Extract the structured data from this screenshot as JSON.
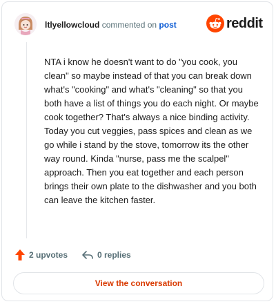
{
  "header": {
    "username": "ltlyellowcloud",
    "action_text": "commented on",
    "post_link": "post",
    "brand": "reddit",
    "brand_color": "#ff4500"
  },
  "comment": {
    "text": "NTA i know he doesn't want to do \"you cook, you clean\" so maybe instead of that you can break down what's \"cooking\" and what's \"cleaning\" so that you both have a list of things you do each night. Or maybe cook together? That's always a nice binding activity. Today you cut veggies, pass spices and clean as we go while i stand by the stove, tomorrow its the other way round. Kinda \"nurse, pass me the scalpel\" approach. Then you eat together and each person brings their own plate to the dishwasher and you both can leave the kitchen faster."
  },
  "actions": {
    "upvotes_label": "2 upvotes",
    "upvote_icon": "upvote-arrow-icon",
    "replies_label": "0 replies",
    "reply_icon": "reply-arrow-icon",
    "accent_color": "#ff4500"
  },
  "footer": {
    "button_label": "View the conversation"
  }
}
